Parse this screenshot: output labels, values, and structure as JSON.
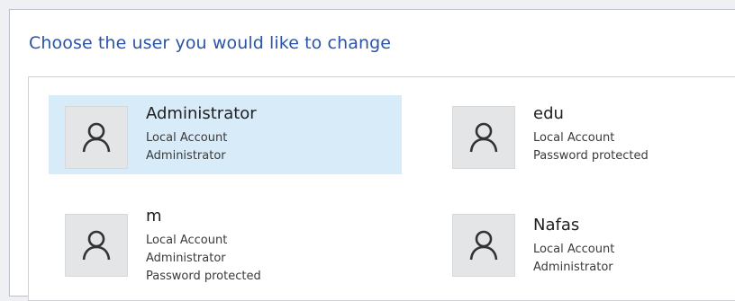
{
  "heading": "Choose the user you would like to change",
  "users": [
    {
      "name": "Administrator",
      "details": [
        "Local Account",
        "Administrator"
      ],
      "icon": "user-icon"
    },
    {
      "name": "edu",
      "details": [
        "Local Account",
        "Password protected"
      ],
      "icon": "user-icon"
    },
    {
      "name": "m",
      "details": [
        "Local Account",
        "Administrator",
        "Password protected"
      ],
      "icon": "user-icon"
    },
    {
      "name": "Nafas",
      "details": [
        "Local Account",
        "Administrator"
      ],
      "icon": "user-icon"
    }
  ],
  "colors": {
    "heading": "#2a54a8",
    "selected_tile": "#d7ebf9",
    "avatar_bg": "#e4e5e6"
  }
}
